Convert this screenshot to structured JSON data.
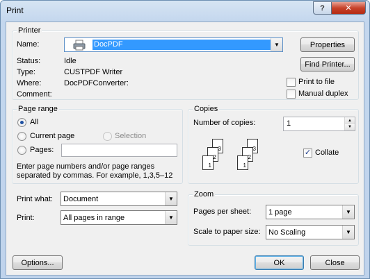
{
  "window": {
    "title": "Print",
    "help_label": "?",
    "close_label": "✕"
  },
  "printer": {
    "group_title": "Printer",
    "name_label": "Name:",
    "name_value": "DocPDF",
    "status_label": "Status:",
    "status_value": "Idle",
    "type_label": "Type:",
    "type_value": "CUSTPDF Writer",
    "where_label": "Where:",
    "where_value": "DocPDFConverter:",
    "comment_label": "Comment:",
    "comment_value": "",
    "properties_button": "Properties",
    "find_printer_button": "Find Printer...",
    "print_to_file_label": "Print to file",
    "print_to_file_checked": false,
    "manual_duplex_label": "Manual duplex",
    "manual_duplex_checked": false
  },
  "page_range": {
    "group_title": "Page range",
    "all_label": "All",
    "current_page_label": "Current page",
    "selection_label": "Selection",
    "pages_label": "Pages:",
    "pages_value": "",
    "selected": "all",
    "hint_line1": "Enter page numbers and/or page ranges",
    "hint_line2": "separated by commas.  For example, 1,3,5–12"
  },
  "copies": {
    "group_title": "Copies",
    "number_label": "Number of copies:",
    "number_value": "1",
    "collate_label": "Collate",
    "collate_checked": true,
    "collate_icon_pages": [
      "1",
      "2",
      "3"
    ]
  },
  "print_what": {
    "label": "Print what:",
    "value": "Document"
  },
  "print": {
    "label": "Print:",
    "value": "All pages in range"
  },
  "zoom": {
    "group_title": "Zoom",
    "pages_per_sheet_label": "Pages per sheet:",
    "pages_per_sheet_value": "1 page",
    "scale_label": "Scale to paper size:",
    "scale_value": "No Scaling"
  },
  "footer": {
    "options_button": "Options...",
    "ok_button": "OK",
    "close_button": "Close"
  },
  "icons": {
    "check": "✓",
    "dropdown": "▼",
    "spin_up": "▲",
    "spin_down": "▼"
  },
  "colors": {
    "selection_highlight": "#3399ff",
    "title_bar": "#c4d7ee",
    "close_button": "#c7432b"
  }
}
